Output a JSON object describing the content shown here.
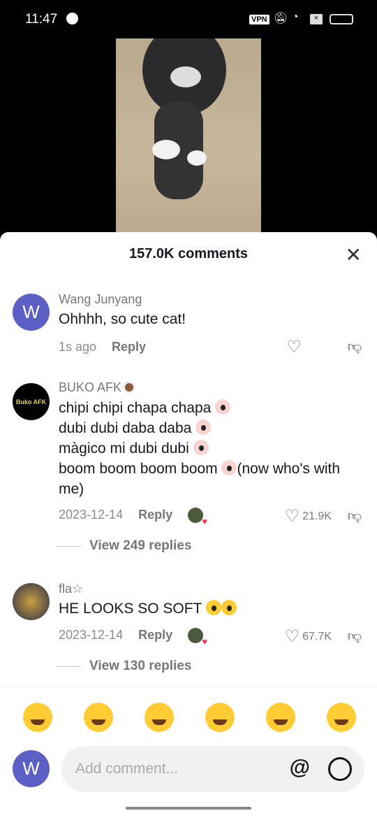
{
  "status": {
    "time": "11:47",
    "vpn": "VPN",
    "icons": [
      "app-notification-icon",
      "vpn-icon",
      "mute-icon",
      "wifi-icon",
      "sim-x-icon",
      "battery-icon"
    ]
  },
  "sheet": {
    "title": "157.0K comments"
  },
  "comments": [
    {
      "avatar_letter": "W",
      "avatar_color": "#5c5fc4",
      "name": "Wang Junyang",
      "text": "Ohhhh, so cute cat!",
      "time": "1s ago",
      "reply": "Reply"
    },
    {
      "avatar_text": "Buko AFK",
      "name": "BUKO AFK",
      "lines": [
        "chipi chipi chapa chapa",
        "dubi dubi daba daba",
        "màgico mi dubi dubi",
        "boom boom boom boom",
        "(now who's with me)"
      ],
      "time": "2023-12-14",
      "reply": "Reply",
      "likes": "21.9K",
      "view_replies": "View 249 replies"
    },
    {
      "name": "fla☆",
      "text": "HE LOOKS SO SOFT",
      "time": "2023-12-14",
      "reply": "Reply",
      "likes": "67.7K",
      "view_replies": "View 130 replies"
    }
  ],
  "emoji_bar": [
    "grinning-face",
    "smiling-face-with-hearts",
    "face-with-tears-of-joy",
    "flushed-face",
    "smirking-face",
    "grinning-sweat-face"
  ],
  "composer": {
    "avatar_letter": "W",
    "placeholder": "Add comment..."
  }
}
